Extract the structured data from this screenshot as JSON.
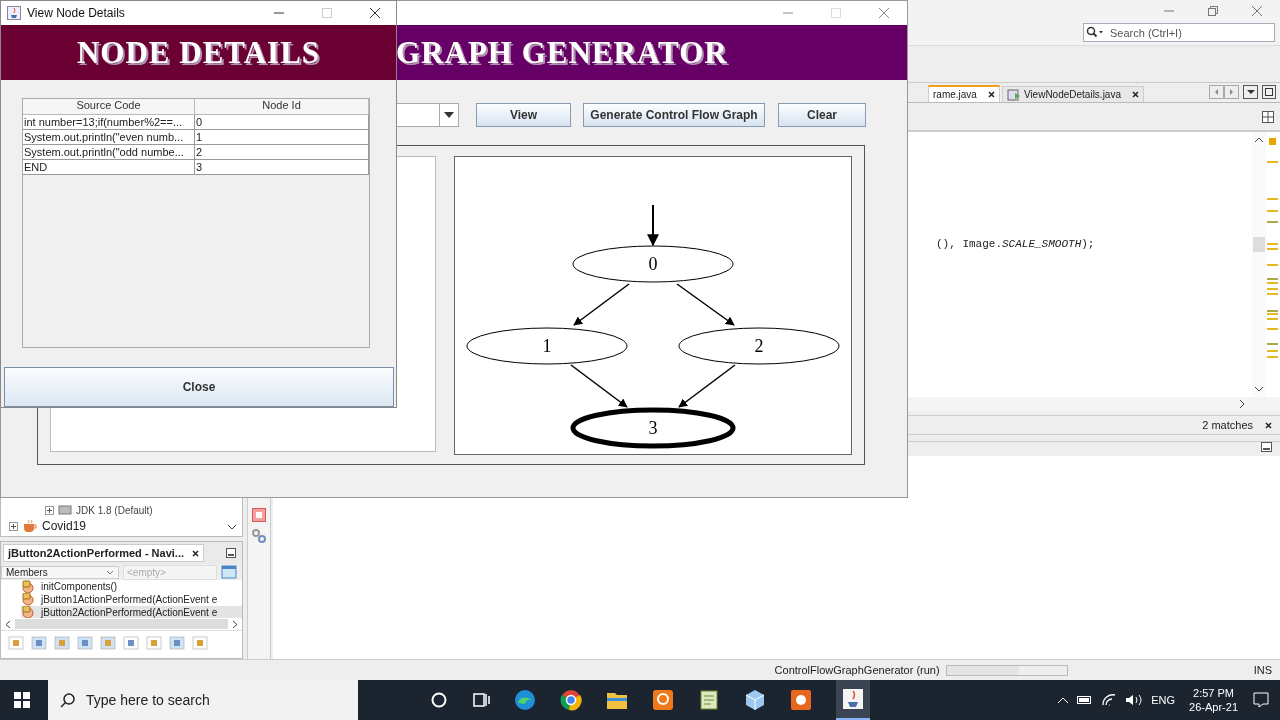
{
  "ide": {
    "search": {
      "placeholder": "Search (Ctrl+I)"
    },
    "editor_tabs": [
      {
        "label": "rame.java",
        "selected": true
      },
      {
        "label": "ViewNodeDetails.java",
        "selected": false
      }
    ],
    "code_line": "(), Image.*SCALE_SMOOTH*);",
    "find_bar": {
      "matches": "2 matches"
    },
    "project_tree": [
      {
        "label": "JDK 1.8 (Default)"
      },
      {
        "label": "Covid19"
      }
    ],
    "navigator": {
      "title": "jButton2ActionPerformed - Navi...",
      "filter": "Members",
      "filter_2": {
        "placeholder": "<empty>"
      },
      "members": [
        {
          "label": "initComponents()",
          "selected": false
        },
        {
          "label": "jButton1ActionPerformed(ActionEvent e",
          "selected": false
        },
        {
          "label": "jButton2ActionPerformed(ActionEvent e",
          "selected": true
        }
      ]
    },
    "status_bar": {
      "task": "ControlFlowGraphGenerator (run)",
      "progress": {
        "level": 0.6
      },
      "mode": "INS"
    }
  },
  "main_window": {
    "banner": "GRAPH GENERATOR",
    "buttons": [
      "View",
      "Generate Control Flow Graph",
      "Clear"
    ],
    "graph": {
      "nodes": [
        {
          "label": "0",
          "kind": "normal"
        },
        {
          "label": "1",
          "kind": "normal"
        },
        {
          "label": "2",
          "kind": "normal"
        },
        {
          "label": "3",
          "kind": "final"
        }
      ]
    }
  },
  "dialog": {
    "title": "View Node Details",
    "banner": "NODE DETAILS",
    "table": {
      "columns": [
        "Source Code",
        "Node Id"
      ],
      "rows": [
        [
          "int number=13;if(number%2==...",
          "0"
        ],
        [
          "System.out.println(\"even numb...",
          "1"
        ],
        [
          "System.out.println(\"odd numbe...",
          "2"
        ],
        [
          "END",
          "3"
        ]
      ]
    },
    "close_button": "Close"
  },
  "taskbar": {
    "search_placeholder": "Type here to search",
    "language": "ENG",
    "time": "2:57 PM",
    "date": "26-Apr-21"
  }
}
